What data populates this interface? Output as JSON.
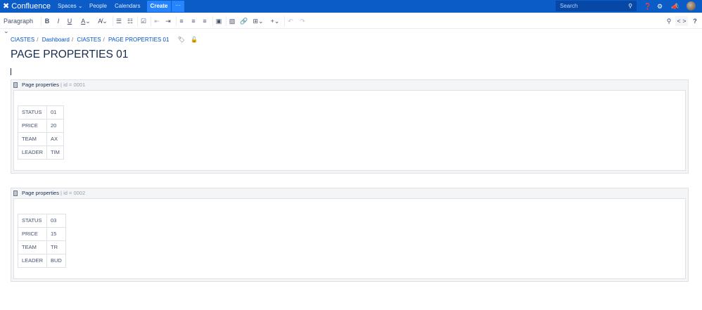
{
  "nav": {
    "logo": "Confluence",
    "spaces": "Spaces ⌄",
    "people": "People",
    "calendars": "Calendars",
    "create": "Create",
    "more": "···",
    "search_placeholder": "Search"
  },
  "toolbar": {
    "paragraph": "Paragraph ⌄",
    "code": "< >",
    "help": "?"
  },
  "breadcrumb": [
    "CIASTES",
    "Dashboard",
    "CIASTES",
    "PAGE PROPERTIES 01"
  ],
  "title": "PAGE PROPERTIES 01",
  "macros": [
    {
      "label": "Page properties",
      "params": "| id = 0001",
      "rows": [
        [
          "STATUS",
          "01"
        ],
        [
          "PRICE",
          "20"
        ],
        [
          "TEAM",
          "AX"
        ],
        [
          "LEADER",
          "TIM"
        ]
      ]
    },
    {
      "label": "Page properties",
      "params": "| id = 0002",
      "rows": [
        [
          "STATUS",
          "03"
        ],
        [
          "PRICE",
          "15"
        ],
        [
          "TEAM",
          "TR"
        ],
        [
          "LEADER",
          "BUD"
        ]
      ]
    }
  ]
}
